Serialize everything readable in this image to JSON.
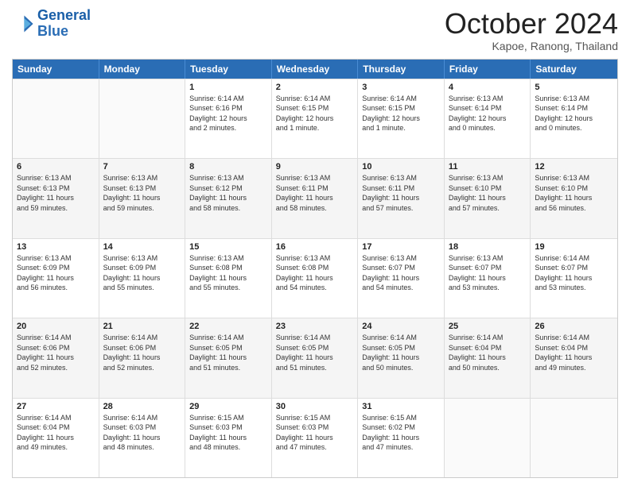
{
  "logo": {
    "line1": "General",
    "line2": "Blue"
  },
  "title": "October 2024",
  "location": "Kapoe, Ranong, Thailand",
  "weekdays": [
    "Sunday",
    "Monday",
    "Tuesday",
    "Wednesday",
    "Thursday",
    "Friday",
    "Saturday"
  ],
  "weeks": [
    [
      {
        "day": "",
        "info": ""
      },
      {
        "day": "",
        "info": ""
      },
      {
        "day": "1",
        "info": "Sunrise: 6:14 AM\nSunset: 6:16 PM\nDaylight: 12 hours\nand 2 minutes."
      },
      {
        "day": "2",
        "info": "Sunrise: 6:14 AM\nSunset: 6:15 PM\nDaylight: 12 hours\nand 1 minute."
      },
      {
        "day": "3",
        "info": "Sunrise: 6:14 AM\nSunset: 6:15 PM\nDaylight: 12 hours\nand 1 minute."
      },
      {
        "day": "4",
        "info": "Sunrise: 6:13 AM\nSunset: 6:14 PM\nDaylight: 12 hours\nand 0 minutes."
      },
      {
        "day": "5",
        "info": "Sunrise: 6:13 AM\nSunset: 6:14 PM\nDaylight: 12 hours\nand 0 minutes."
      }
    ],
    [
      {
        "day": "6",
        "info": "Sunrise: 6:13 AM\nSunset: 6:13 PM\nDaylight: 11 hours\nand 59 minutes."
      },
      {
        "day": "7",
        "info": "Sunrise: 6:13 AM\nSunset: 6:13 PM\nDaylight: 11 hours\nand 59 minutes."
      },
      {
        "day": "8",
        "info": "Sunrise: 6:13 AM\nSunset: 6:12 PM\nDaylight: 11 hours\nand 58 minutes."
      },
      {
        "day": "9",
        "info": "Sunrise: 6:13 AM\nSunset: 6:11 PM\nDaylight: 11 hours\nand 58 minutes."
      },
      {
        "day": "10",
        "info": "Sunrise: 6:13 AM\nSunset: 6:11 PM\nDaylight: 11 hours\nand 57 minutes."
      },
      {
        "day": "11",
        "info": "Sunrise: 6:13 AM\nSunset: 6:10 PM\nDaylight: 11 hours\nand 57 minutes."
      },
      {
        "day": "12",
        "info": "Sunrise: 6:13 AM\nSunset: 6:10 PM\nDaylight: 11 hours\nand 56 minutes."
      }
    ],
    [
      {
        "day": "13",
        "info": "Sunrise: 6:13 AM\nSunset: 6:09 PM\nDaylight: 11 hours\nand 56 minutes."
      },
      {
        "day": "14",
        "info": "Sunrise: 6:13 AM\nSunset: 6:09 PM\nDaylight: 11 hours\nand 55 minutes."
      },
      {
        "day": "15",
        "info": "Sunrise: 6:13 AM\nSunset: 6:08 PM\nDaylight: 11 hours\nand 55 minutes."
      },
      {
        "day": "16",
        "info": "Sunrise: 6:13 AM\nSunset: 6:08 PM\nDaylight: 11 hours\nand 54 minutes."
      },
      {
        "day": "17",
        "info": "Sunrise: 6:13 AM\nSunset: 6:07 PM\nDaylight: 11 hours\nand 54 minutes."
      },
      {
        "day": "18",
        "info": "Sunrise: 6:13 AM\nSunset: 6:07 PM\nDaylight: 11 hours\nand 53 minutes."
      },
      {
        "day": "19",
        "info": "Sunrise: 6:14 AM\nSunset: 6:07 PM\nDaylight: 11 hours\nand 53 minutes."
      }
    ],
    [
      {
        "day": "20",
        "info": "Sunrise: 6:14 AM\nSunset: 6:06 PM\nDaylight: 11 hours\nand 52 minutes."
      },
      {
        "day": "21",
        "info": "Sunrise: 6:14 AM\nSunset: 6:06 PM\nDaylight: 11 hours\nand 52 minutes."
      },
      {
        "day": "22",
        "info": "Sunrise: 6:14 AM\nSunset: 6:05 PM\nDaylight: 11 hours\nand 51 minutes."
      },
      {
        "day": "23",
        "info": "Sunrise: 6:14 AM\nSunset: 6:05 PM\nDaylight: 11 hours\nand 51 minutes."
      },
      {
        "day": "24",
        "info": "Sunrise: 6:14 AM\nSunset: 6:05 PM\nDaylight: 11 hours\nand 50 minutes."
      },
      {
        "day": "25",
        "info": "Sunrise: 6:14 AM\nSunset: 6:04 PM\nDaylight: 11 hours\nand 50 minutes."
      },
      {
        "day": "26",
        "info": "Sunrise: 6:14 AM\nSunset: 6:04 PM\nDaylight: 11 hours\nand 49 minutes."
      }
    ],
    [
      {
        "day": "27",
        "info": "Sunrise: 6:14 AM\nSunset: 6:04 PM\nDaylight: 11 hours\nand 49 minutes."
      },
      {
        "day": "28",
        "info": "Sunrise: 6:14 AM\nSunset: 6:03 PM\nDaylight: 11 hours\nand 48 minutes."
      },
      {
        "day": "29",
        "info": "Sunrise: 6:15 AM\nSunset: 6:03 PM\nDaylight: 11 hours\nand 48 minutes."
      },
      {
        "day": "30",
        "info": "Sunrise: 6:15 AM\nSunset: 6:03 PM\nDaylight: 11 hours\nand 47 minutes."
      },
      {
        "day": "31",
        "info": "Sunrise: 6:15 AM\nSunset: 6:02 PM\nDaylight: 11 hours\nand 47 minutes."
      },
      {
        "day": "",
        "info": ""
      },
      {
        "day": "",
        "info": ""
      }
    ]
  ]
}
